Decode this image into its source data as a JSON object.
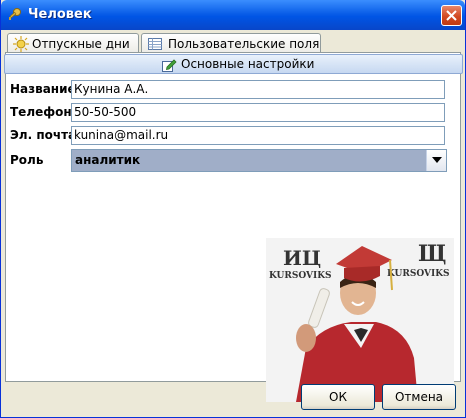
{
  "window": {
    "title": "Человек",
    "title_icon": "key-icon",
    "close_icon": "close-icon"
  },
  "tabs": [
    {
      "label": "Отпускные дни",
      "icon": "sun-icon"
    },
    {
      "label": "Пользовательские поля",
      "icon": "table-icon"
    }
  ],
  "active_subtab": {
    "label": "Основные настройки",
    "icon": "edit-icon"
  },
  "form": {
    "name_label": "Название",
    "name_value": "Кунина А.А.",
    "phone_label": "Телефон",
    "phone_value": "50-50-500",
    "email_label": "Эл. почта",
    "email_value": "kunina@mail.ru",
    "role_label": "Роль",
    "role_value": "аналитик"
  },
  "watermark": {
    "text_left": "ИЦ",
    "brand_left": "KURSOVIKS",
    "text_right": "Щ",
    "brand_right": "KURSOVIKS"
  },
  "buttons": {
    "ok": "ОК",
    "cancel": "Отмена"
  }
}
